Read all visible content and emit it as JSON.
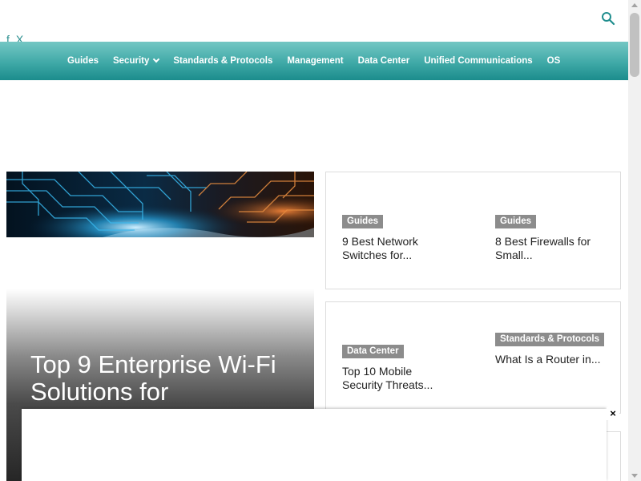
{
  "header": {
    "social_icons": [
      "facebook-icon",
      "x-icon"
    ],
    "search_icon": "search-icon"
  },
  "nav": {
    "items": [
      {
        "label": "Guides"
      },
      {
        "label": "Security",
        "has_dropdown": true
      },
      {
        "label": "Standards & Protocols"
      },
      {
        "label": "Management"
      },
      {
        "label": "Data Center"
      },
      {
        "label": "Unified Communications"
      },
      {
        "label": "OS"
      }
    ]
  },
  "feature": {
    "title": "Top 9 Enterprise Wi-Fi Solutions for"
  },
  "cards": [
    {
      "items": [
        {
          "badge": "Guides",
          "title": "9 Best Network Switches for..."
        },
        {
          "badge": "Guides",
          "title": "8 Best Firewalls for Small..."
        }
      ]
    },
    {
      "items": [
        {
          "badge": "Data Center",
          "title": "Top 10 Mobile Security Threats..."
        },
        {
          "badge": "Standards & Protocols",
          "title": "What Is a Router in..."
        }
      ]
    }
  ],
  "ad": {
    "close_label": "×"
  },
  "colors": {
    "nav_accent": "#3fa9a7",
    "badge": "#8c8c8c",
    "icon_teal": "#2a8f8f"
  }
}
